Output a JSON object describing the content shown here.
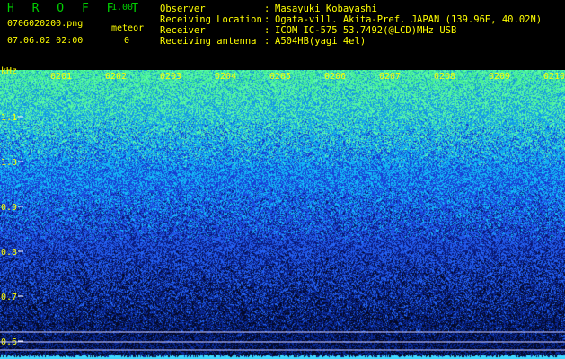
{
  "header": {
    "app_title": "H R O F F T",
    "version": "1.00",
    "filename": "0706020200.png",
    "meteor_label": "meteor",
    "datetime": "07.06.02 02:00",
    "meteor_count": "0"
  },
  "info": {
    "rows": [
      {
        "label": "Observer",
        "value": "Masayuki Kobayashi"
      },
      {
        "label": "Receiving Location",
        "value": "Ogata-vill. Akita-Pref. JAPAN (139.96E, 40.02N)"
      },
      {
        "label": "Receiver",
        "value": "ICOM IC-575 53.7492(@LCD)MHz USB"
      },
      {
        "label": "Receiving antenna",
        "value": "A504HB(yagi 4el)"
      }
    ]
  },
  "axis": {
    "unit": "kHz",
    "y_ticks": [
      "1.1",
      "1.0",
      "0.9",
      "0.8",
      "0.7",
      "0.6"
    ],
    "x_ticks": [
      "0201",
      "0202",
      "0203",
      "0204",
      "0205",
      "0206",
      "0207",
      "0208",
      "0209",
      "0210"
    ]
  },
  "colors": {
    "background": "#000000",
    "label_yellow": "#ffff00",
    "title_green": "#00d000",
    "spectrum_high": "#22ff88",
    "spectrum_mid": "#1e3cff",
    "spectrum_low": "#08104a"
  }
}
